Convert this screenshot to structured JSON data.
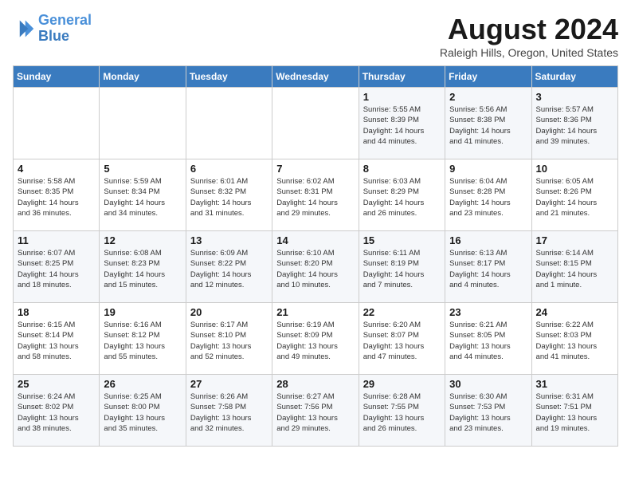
{
  "logo": {
    "line1": "General",
    "line2": "Blue"
  },
  "title": "August 2024",
  "location": "Raleigh Hills, Oregon, United States",
  "weekdays": [
    "Sunday",
    "Monday",
    "Tuesday",
    "Wednesday",
    "Thursday",
    "Friday",
    "Saturday"
  ],
  "weeks": [
    [
      {
        "day": "",
        "info": ""
      },
      {
        "day": "",
        "info": ""
      },
      {
        "day": "",
        "info": ""
      },
      {
        "day": "",
        "info": ""
      },
      {
        "day": "1",
        "info": "Sunrise: 5:55 AM\nSunset: 8:39 PM\nDaylight: 14 hours\nand 44 minutes."
      },
      {
        "day": "2",
        "info": "Sunrise: 5:56 AM\nSunset: 8:38 PM\nDaylight: 14 hours\nand 41 minutes."
      },
      {
        "day": "3",
        "info": "Sunrise: 5:57 AM\nSunset: 8:36 PM\nDaylight: 14 hours\nand 39 minutes."
      }
    ],
    [
      {
        "day": "4",
        "info": "Sunrise: 5:58 AM\nSunset: 8:35 PM\nDaylight: 14 hours\nand 36 minutes."
      },
      {
        "day": "5",
        "info": "Sunrise: 5:59 AM\nSunset: 8:34 PM\nDaylight: 14 hours\nand 34 minutes."
      },
      {
        "day": "6",
        "info": "Sunrise: 6:01 AM\nSunset: 8:32 PM\nDaylight: 14 hours\nand 31 minutes."
      },
      {
        "day": "7",
        "info": "Sunrise: 6:02 AM\nSunset: 8:31 PM\nDaylight: 14 hours\nand 29 minutes."
      },
      {
        "day": "8",
        "info": "Sunrise: 6:03 AM\nSunset: 8:29 PM\nDaylight: 14 hours\nand 26 minutes."
      },
      {
        "day": "9",
        "info": "Sunrise: 6:04 AM\nSunset: 8:28 PM\nDaylight: 14 hours\nand 23 minutes."
      },
      {
        "day": "10",
        "info": "Sunrise: 6:05 AM\nSunset: 8:26 PM\nDaylight: 14 hours\nand 21 minutes."
      }
    ],
    [
      {
        "day": "11",
        "info": "Sunrise: 6:07 AM\nSunset: 8:25 PM\nDaylight: 14 hours\nand 18 minutes."
      },
      {
        "day": "12",
        "info": "Sunrise: 6:08 AM\nSunset: 8:23 PM\nDaylight: 14 hours\nand 15 minutes."
      },
      {
        "day": "13",
        "info": "Sunrise: 6:09 AM\nSunset: 8:22 PM\nDaylight: 14 hours\nand 12 minutes."
      },
      {
        "day": "14",
        "info": "Sunrise: 6:10 AM\nSunset: 8:20 PM\nDaylight: 14 hours\nand 10 minutes."
      },
      {
        "day": "15",
        "info": "Sunrise: 6:11 AM\nSunset: 8:19 PM\nDaylight: 14 hours\nand 7 minutes."
      },
      {
        "day": "16",
        "info": "Sunrise: 6:13 AM\nSunset: 8:17 PM\nDaylight: 14 hours\nand 4 minutes."
      },
      {
        "day": "17",
        "info": "Sunrise: 6:14 AM\nSunset: 8:15 PM\nDaylight: 14 hours\nand 1 minute."
      }
    ],
    [
      {
        "day": "18",
        "info": "Sunrise: 6:15 AM\nSunset: 8:14 PM\nDaylight: 13 hours\nand 58 minutes."
      },
      {
        "day": "19",
        "info": "Sunrise: 6:16 AM\nSunset: 8:12 PM\nDaylight: 13 hours\nand 55 minutes."
      },
      {
        "day": "20",
        "info": "Sunrise: 6:17 AM\nSunset: 8:10 PM\nDaylight: 13 hours\nand 52 minutes."
      },
      {
        "day": "21",
        "info": "Sunrise: 6:19 AM\nSunset: 8:09 PM\nDaylight: 13 hours\nand 49 minutes."
      },
      {
        "day": "22",
        "info": "Sunrise: 6:20 AM\nSunset: 8:07 PM\nDaylight: 13 hours\nand 47 minutes."
      },
      {
        "day": "23",
        "info": "Sunrise: 6:21 AM\nSunset: 8:05 PM\nDaylight: 13 hours\nand 44 minutes."
      },
      {
        "day": "24",
        "info": "Sunrise: 6:22 AM\nSunset: 8:03 PM\nDaylight: 13 hours\nand 41 minutes."
      }
    ],
    [
      {
        "day": "25",
        "info": "Sunrise: 6:24 AM\nSunset: 8:02 PM\nDaylight: 13 hours\nand 38 minutes."
      },
      {
        "day": "26",
        "info": "Sunrise: 6:25 AM\nSunset: 8:00 PM\nDaylight: 13 hours\nand 35 minutes."
      },
      {
        "day": "27",
        "info": "Sunrise: 6:26 AM\nSunset: 7:58 PM\nDaylight: 13 hours\nand 32 minutes."
      },
      {
        "day": "28",
        "info": "Sunrise: 6:27 AM\nSunset: 7:56 PM\nDaylight: 13 hours\nand 29 minutes."
      },
      {
        "day": "29",
        "info": "Sunrise: 6:28 AM\nSunset: 7:55 PM\nDaylight: 13 hours\nand 26 minutes."
      },
      {
        "day": "30",
        "info": "Sunrise: 6:30 AM\nSunset: 7:53 PM\nDaylight: 13 hours\nand 23 minutes."
      },
      {
        "day": "31",
        "info": "Sunrise: 6:31 AM\nSunset: 7:51 PM\nDaylight: 13 hours\nand 19 minutes."
      }
    ]
  ]
}
